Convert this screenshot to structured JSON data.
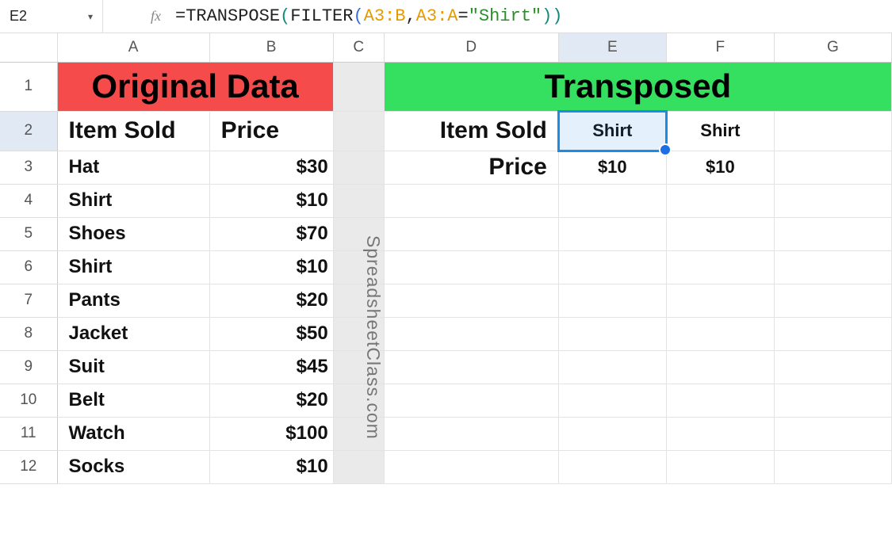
{
  "formula_bar": {
    "cell_ref": "E2",
    "fx_label": "fx",
    "prefix": "=",
    "fn_outer": "TRANSPOSE",
    "paren_open1": "(",
    "fn_inner": "FILTER",
    "paren_open2": "(",
    "range1": "A3:B",
    "comma1": ",",
    "range2": "A3:A",
    "equals": "=",
    "literal": "\"Shirt\"",
    "paren_close": "))"
  },
  "columns": [
    "A",
    "B",
    "C",
    "D",
    "E",
    "F",
    "G"
  ],
  "rows": [
    "1",
    "2",
    "3",
    "4",
    "5",
    "6",
    "7",
    "8",
    "9",
    "10",
    "11",
    "12"
  ],
  "headers": {
    "original": "Original Data",
    "transposed": "Transposed",
    "item_sold": "Item Sold",
    "price": "Price"
  },
  "original_data": [
    {
      "item": "Hat",
      "price": "$30"
    },
    {
      "item": "Shirt",
      "price": "$10"
    },
    {
      "item": "Shoes",
      "price": "$70"
    },
    {
      "item": "Shirt",
      "price": "$10"
    },
    {
      "item": "Pants",
      "price": "$20"
    },
    {
      "item": "Jacket",
      "price": "$50"
    },
    {
      "item": "Suit",
      "price": "$45"
    },
    {
      "item": "Belt",
      "price": "$20"
    },
    {
      "item": "Watch",
      "price": "$100"
    },
    {
      "item": "Socks",
      "price": "$10"
    }
  ],
  "transposed": {
    "row1": {
      "E": "Shirt",
      "F": "Shirt"
    },
    "row2": {
      "E": "$10",
      "F": "$10"
    }
  },
  "watermark": "SpreadsheetClass.com",
  "active_cell": "E2"
}
